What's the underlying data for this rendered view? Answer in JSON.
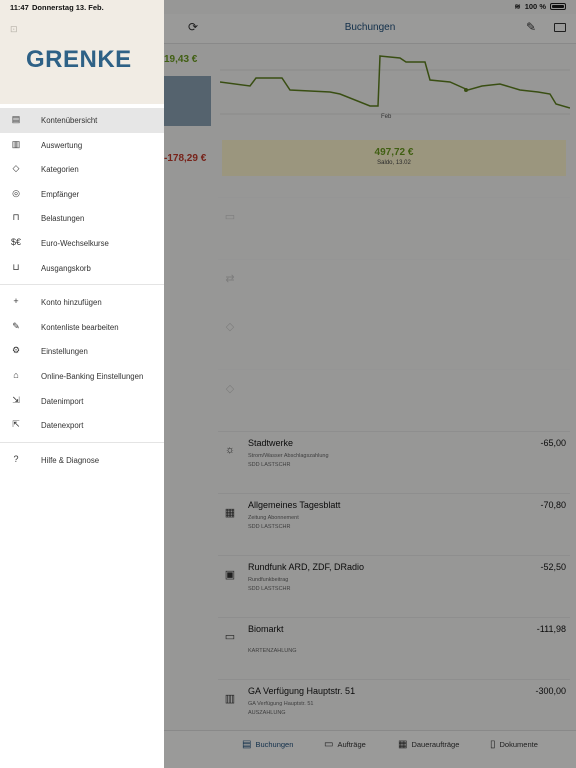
{
  "status_bar": {
    "time": "11:47",
    "date": "Donnerstag 13. Feb.",
    "battery": "100 %"
  },
  "drawer": {
    "logo": "GRENKE",
    "groups": [
      [
        {
          "label": "Kontenübersicht",
          "icon": "accounts-icon",
          "glyph": "▤",
          "active": true
        },
        {
          "label": "Auswertung",
          "icon": "bar-chart-icon",
          "glyph": "▥",
          "active": false
        },
        {
          "label": "Kategorien",
          "icon": "tag-icon",
          "glyph": "◇",
          "active": false
        },
        {
          "label": "Empfänger",
          "icon": "person-icon",
          "glyph": "◎",
          "active": false
        },
        {
          "label": "Belastungen",
          "icon": "stamp-icon",
          "glyph": "⊓",
          "active": false
        },
        {
          "label": "Euro-Wechselkurse",
          "icon": "currency-exchange-icon",
          "glyph": "$€",
          "active": false
        },
        {
          "label": "Ausgangskorb",
          "icon": "tray-icon",
          "glyph": "⊔",
          "active": false
        }
      ],
      [
        {
          "label": "Konto hinzufügen",
          "icon": "plus-icon",
          "glyph": "+",
          "active": false
        },
        {
          "label": "Kontenliste bearbeiten",
          "icon": "pencil-icon",
          "glyph": "✎",
          "active": false
        },
        {
          "label": "Einstellungen",
          "icon": "gear-icon",
          "glyph": "⚙",
          "active": false
        },
        {
          "label": "Online-Banking Einstellungen",
          "icon": "bank-settings-icon",
          "glyph": "⌂",
          "active": false
        },
        {
          "label": "Datenimport",
          "icon": "import-icon",
          "glyph": "⇲",
          "active": false
        },
        {
          "label": "Datenexport",
          "icon": "export-icon",
          "glyph": "⇱",
          "active": false
        }
      ],
      [
        {
          "label": "Hilfe & Diagnose",
          "icon": "help-icon",
          "glyph": "?",
          "active": false
        }
      ]
    ]
  },
  "main": {
    "title": "Buchungen",
    "peek_balance_1": "19,43 €",
    "peek_balance_2": "-178,29 €",
    "chart_label_mid": "Feb",
    "summary_amount": "497,72 €",
    "summary_sub": "Saldo, 13.02",
    "transactions": [
      {
        "name": "Stadtwerke",
        "sub1": "Strom/Wasser Abschlagszahlung",
        "sub2": "SDD LASTSCHR",
        "amount": "-65,00",
        "icon": "lightbulb-icon",
        "glyph": "☼"
      },
      {
        "name": "Allgemeines Tagesblatt",
        "sub1": "Zeitung Abonnement",
        "sub2": "SDD LASTSCHR",
        "amount": "-70,80",
        "icon": "newspaper-icon",
        "glyph": "▦"
      },
      {
        "name": "Rundfunk ARD, ZDF, DRadio",
        "sub1": "Rundfunkbeitrag",
        "sub2": "SDD LASTSCHR",
        "amount": "-52,50",
        "icon": "radio-icon",
        "glyph": "▣"
      },
      {
        "name": "Biomarkt",
        "sub1": "",
        "sub2": "KARTENZAHLUNG",
        "amount": "-111,98",
        "icon": "card-icon",
        "glyph": "▭"
      },
      {
        "name": "GA Verfügung Hauptstr. 51",
        "sub1": "GA Verfügung Hauptstr. 51",
        "sub2": "AUSZAHLUNG",
        "amount": "-300,00",
        "icon": "atm-icon",
        "glyph": "▥"
      }
    ],
    "tabs": [
      {
        "label": "Buchungen",
        "icon": "bookings-icon",
        "glyph": "▤",
        "active": true
      },
      {
        "label": "Aufträge",
        "icon": "orders-icon",
        "glyph": "▭",
        "active": false
      },
      {
        "label": "Daueraufträge",
        "icon": "standing-orders-icon",
        "glyph": "▦",
        "active": false
      },
      {
        "label": "Dokumente",
        "icon": "documents-icon",
        "glyph": "▯",
        "active": false
      }
    ]
  }
}
